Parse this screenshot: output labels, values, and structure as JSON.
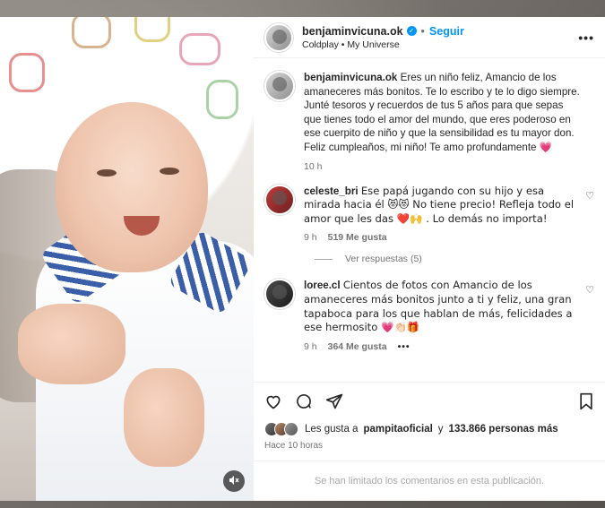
{
  "header": {
    "username": "benjaminvicuna.ok",
    "separator": "•",
    "follow_label": "Seguir",
    "music_artist": "Coldplay",
    "music_separator": " • ",
    "music_track": "My Universe",
    "more_label": "•••"
  },
  "caption": {
    "username": "benjaminvicuna.ok",
    "text": "Eres un niño feliz, Amancio de los amaneceres más bonitos. Te lo escribo y te lo digo siempre. Junté tesoros y recuerdos de tus 5 años para que sepas que tienes todo el amor del mundo, que eres poderoso en ese cuerpito de niño y que la sensibilidad es tu mayor don. Feliz cumpleaños, mi niño! Te amo profundamente",
    "emoji": "💗",
    "time": "10 h"
  },
  "comments": [
    {
      "username": "celeste_bri",
      "text": "Ese papá jugando con su hijo y esa mirada hacia él 😻😻 No tiene precio! Refleja todo el amor que les das ❤️🙌 . Lo demás no importa!",
      "time": "9 h",
      "likes": "519 Me gusta"
    },
    {
      "username": "loree.cl",
      "text": "Cientos de fotos con Amancio de los amaneceres más bonitos junto a ti y feliz, una gran tapaboca para los que hablan de más, felicidades a ese hermosito 💗👏🏻🎁",
      "time": "9 h",
      "likes": "364 Me gusta",
      "more": "•••"
    }
  ],
  "view_replies": "Ver respuestas (5)",
  "likes": {
    "prefix": "Les gusta a",
    "user": "pampitaoficial",
    "connector": "y",
    "count": "133.866 personas más"
  },
  "time_ago": "Hace 10 horas",
  "comments_limited": "Se han limitado los comentarios en esta publicación.",
  "icons": {
    "verified": "verified-badge-icon",
    "like": "heart-outline-icon",
    "comment": "comment-bubble-icon",
    "share": "paper-plane-icon",
    "save": "bookmark-icon",
    "mute": "speaker-muted-icon"
  },
  "colors": {
    "accent": "#0095f6",
    "text": "#262626",
    "muted": "#737373"
  }
}
